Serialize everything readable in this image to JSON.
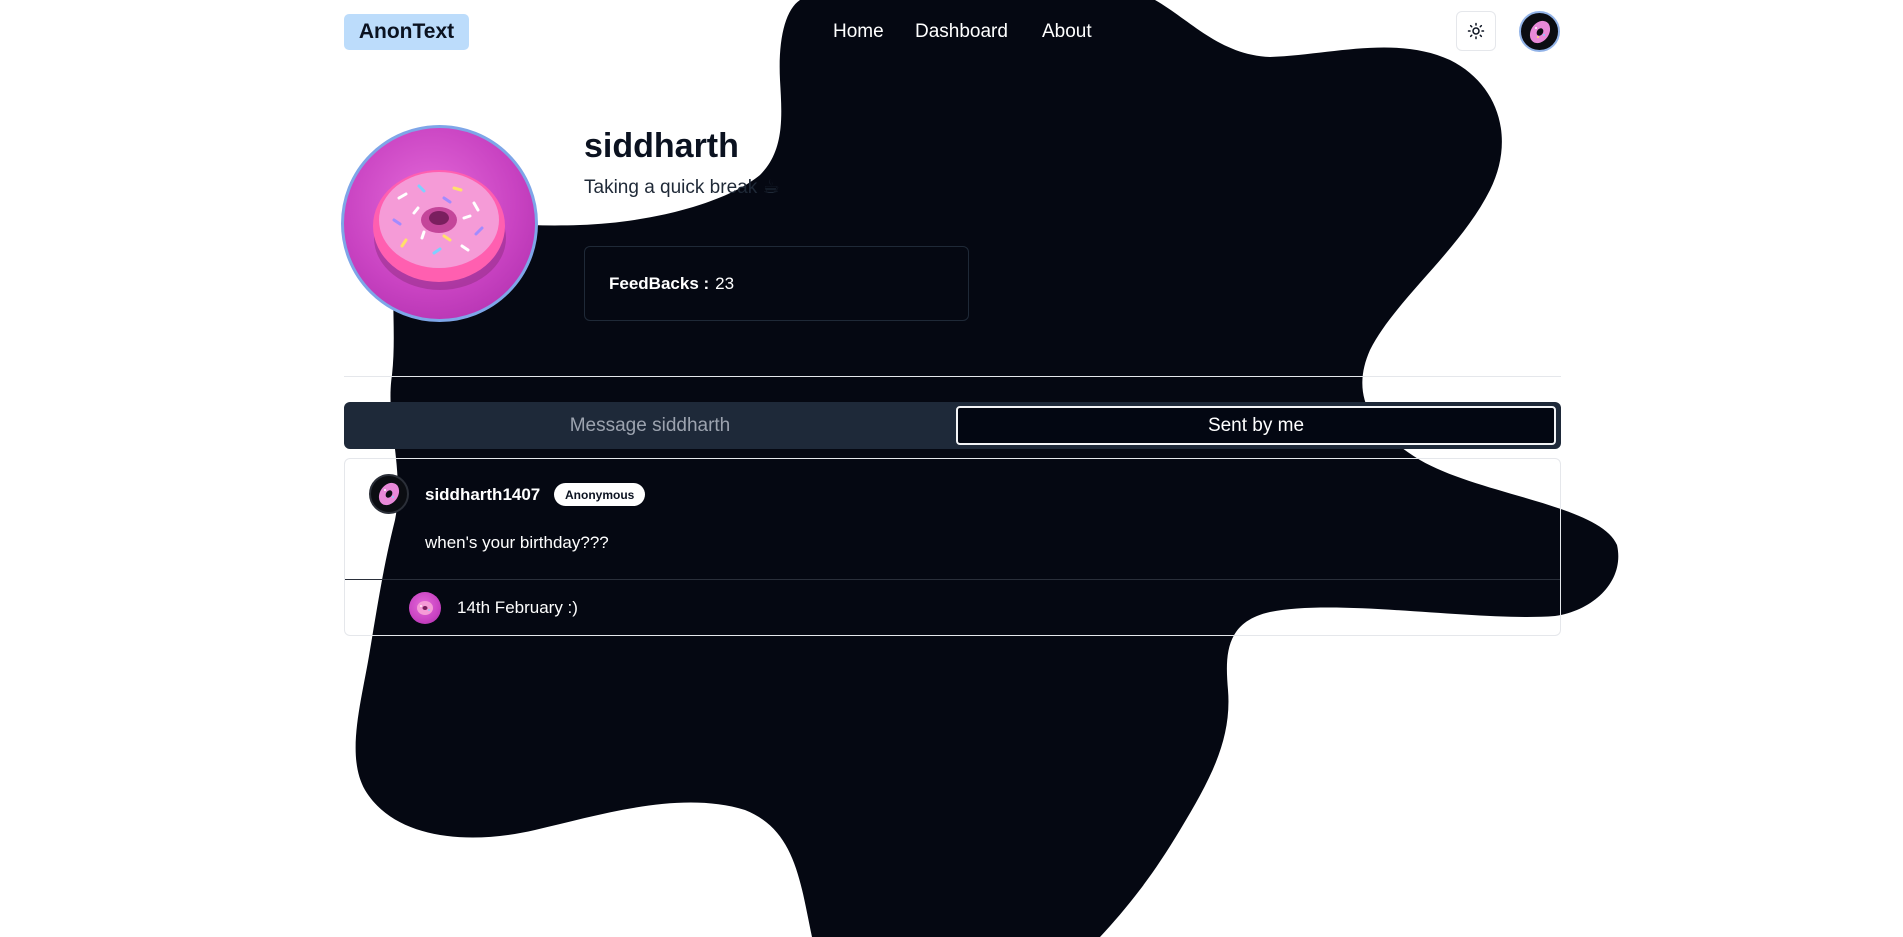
{
  "header": {
    "logo": "AnonText",
    "nav": {
      "home": "Home",
      "dashboard": "Dashboard",
      "about": "About"
    },
    "theme_icon": "sun-icon",
    "avatar_icon": "donut-avatar"
  },
  "profile": {
    "name": "siddharth",
    "status": "Taking a quick break ☕",
    "feedbacks_label": "FeedBacks :",
    "feedbacks_count": "23"
  },
  "tabs": {
    "message": "Message siddharth",
    "sent": "Sent by me",
    "active": "sent"
  },
  "messages": [
    {
      "username": "siddharth1407",
      "badge": "Anonymous",
      "text": "when's your birthday???",
      "reply": "14th February :)"
    }
  ],
  "colors": {
    "blob": "#050812",
    "logo_bg": "#bcdcfb",
    "avatar_border": "#7ea6e8",
    "donut_pink": "#c943c2",
    "tab_bar": "#1e2939"
  }
}
